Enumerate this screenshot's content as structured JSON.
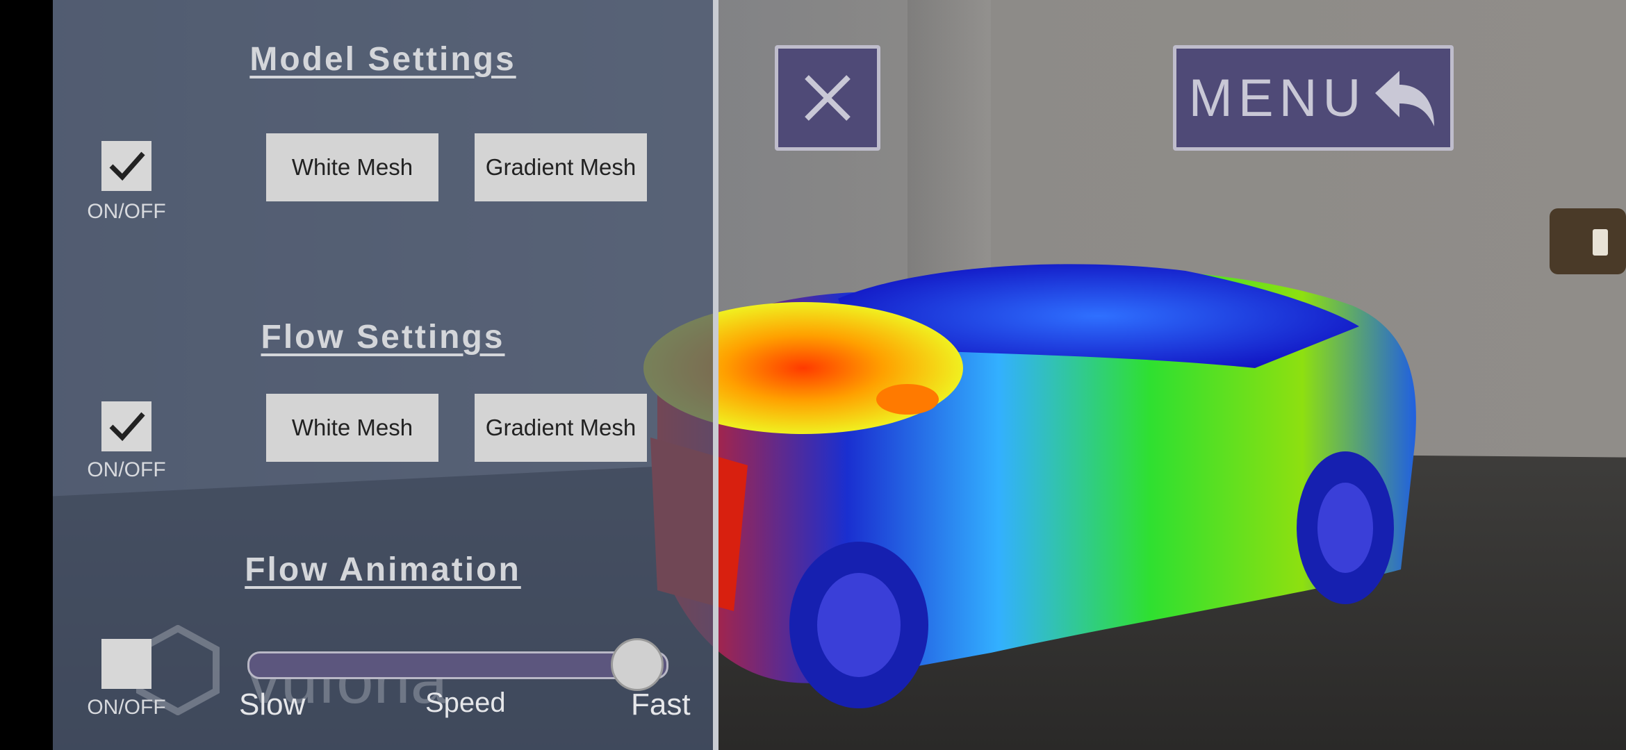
{
  "model_settings": {
    "title": "Model Settings",
    "toggle_label": "ON/OFF",
    "toggle_checked": true,
    "white_mesh_label": "White Mesh",
    "gradient_mesh_label": "Gradient Mesh"
  },
  "flow_settings": {
    "title": "Flow Settings",
    "toggle_label": "ON/OFF",
    "toggle_checked": true,
    "white_mesh_label": "White Mesh",
    "gradient_mesh_label": "Gradient Mesh"
  },
  "flow_animation": {
    "title": "Flow Animation",
    "toggle_label": "ON/OFF",
    "toggle_checked": false,
    "slider_min_label": "Slow",
    "slider_mid_label": "Speed",
    "slider_max_label": "Fast",
    "speed_fraction": 0.93
  },
  "watermark": {
    "text": "vuforia"
  },
  "top_bar": {
    "menu_label": "MENU",
    "close_icon": "close-icon",
    "back_icon": "reply-arrow-icon"
  },
  "colors": {
    "panel_overlay": "#485670",
    "button_fill": "#4f4a77",
    "slider_track": "#5c567e"
  }
}
